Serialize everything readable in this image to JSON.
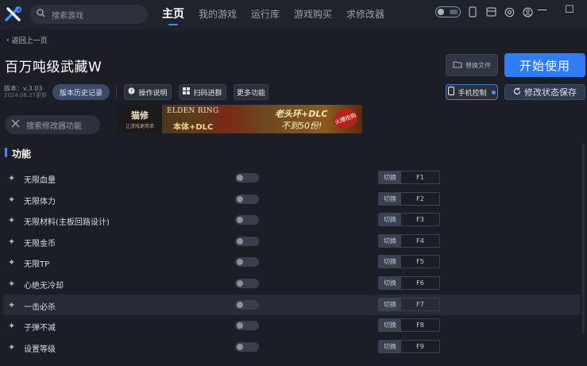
{
  "header": {
    "search_placeholder": "搜索游戏",
    "nav": [
      {
        "label": "主页",
        "active": true
      },
      {
        "label": "我的游戏"
      },
      {
        "label": "运行库"
      },
      {
        "label": "游戏购买"
      },
      {
        "label": "求修改器"
      }
    ],
    "window_controls": [
      "—",
      "☐",
      "✕"
    ]
  },
  "back_label": "返回上一页",
  "game": {
    "title": "百万吨级武藏W",
    "version": "版本：v.3.03",
    "updated": "2024.06.27更新"
  },
  "toolbar": {
    "history": "版本历史记录",
    "help": "操作说明",
    "scan": "扫码进群",
    "more": "更多功能",
    "replace": "替换文件",
    "start": "开始使用",
    "phone": "手机控制",
    "save": "修改状态保存"
  },
  "mod_search_placeholder": "搜索修改器功能",
  "banner": {
    "brand": "猫修",
    "brand_sub": "让游戏更简单",
    "game_line1": "ELDEN RING",
    "game_line2": "本体+DLC",
    "promo": "老头环+DLC",
    "promo_count": "不到50份!",
    "badge": "火爆抢购"
  },
  "section": {
    "title": "功能"
  },
  "hotkey_prefix": "切换",
  "features": [
    {
      "label": "无限血量",
      "key": "F1",
      "enabled": false
    },
    {
      "label": "无限体力",
      "key": "F2",
      "enabled": false
    },
    {
      "label": "无限材料(主板回路设计)",
      "key": "F3",
      "enabled": false
    },
    {
      "label": "无限金币",
      "key": "F4",
      "enabled": false
    },
    {
      "label": "无限TP",
      "key": "F5",
      "enabled": false
    },
    {
      "label": "心绝无冷却",
      "key": "F6",
      "enabled": false
    },
    {
      "label": "一击必杀",
      "key": "F7",
      "enabled": false
    },
    {
      "label": "子弹不减",
      "key": "F8",
      "enabled": false
    },
    {
      "label": "设置等级",
      "key": "F9",
      "enabled": false
    }
  ],
  "colors": {
    "accent": "#2f7df6",
    "background": "#1b1e26"
  }
}
